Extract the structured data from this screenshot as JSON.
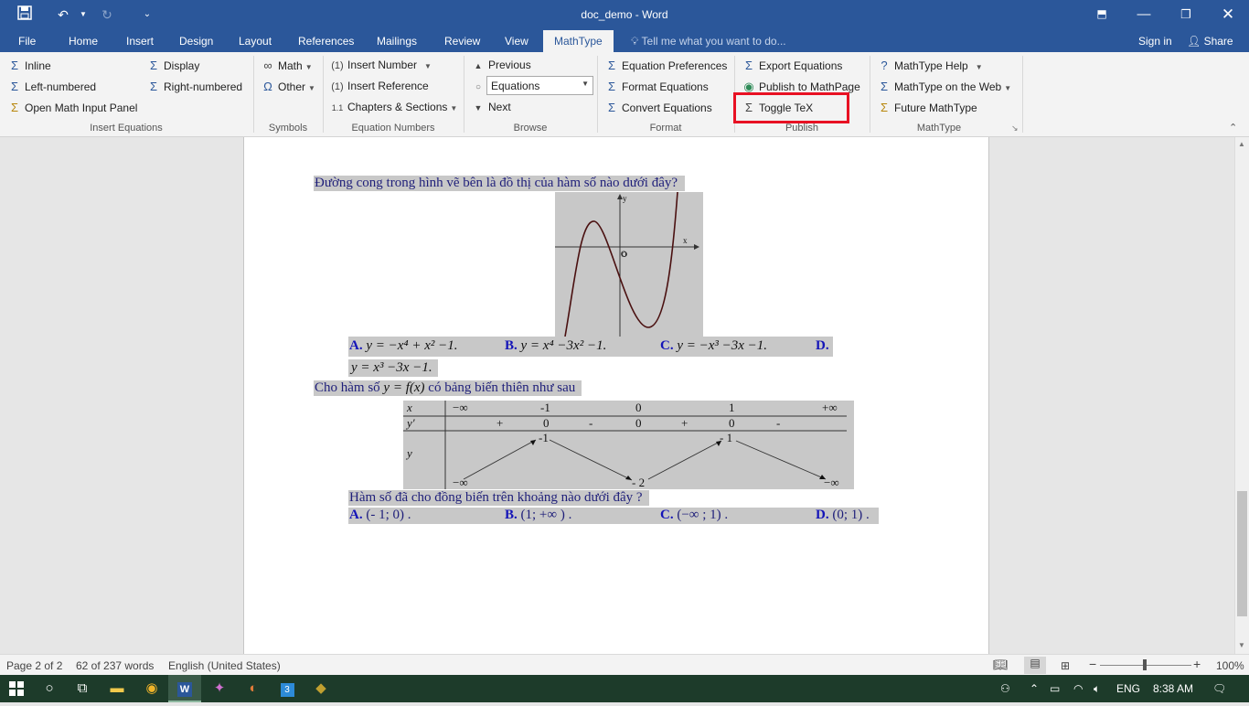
{
  "titlebar": {
    "title": "doc_demo  -  Word",
    "save_icon": "save-icon",
    "undo_icon": "undo-icon",
    "redo_icon": "redo-icon"
  },
  "tabs": [
    "File",
    "Home",
    "Insert",
    "Design",
    "Layout",
    "References",
    "Mailings",
    "Review",
    "View",
    "MathType"
  ],
  "tell_me": "Tell me what you want to do...",
  "account": {
    "sign_in": "Sign in",
    "share": "Share"
  },
  "ribbon": {
    "insert_equations": {
      "inline": "Inline",
      "display": "Display",
      "left_numbered": "Left-numbered",
      "right_numbered": "Right-numbered",
      "open_math_input": "Open Math Input Panel",
      "label": "Insert Equations"
    },
    "symbols": {
      "math": "Math",
      "other": "Other",
      "label": "Symbols"
    },
    "equation_numbers": {
      "insert_number": "Insert Number",
      "insert_reference": "Insert Reference",
      "chapters_sections": "Chapters & Sections",
      "label": "Equation Numbers"
    },
    "browse": {
      "previous": "Previous",
      "selected": "Equations",
      "next": "Next",
      "label": "Browse"
    },
    "format": {
      "equation_preferences": "Equation Preferences",
      "format_equations": "Format Equations",
      "convert_equations": "Convert Equations",
      "label": "Format"
    },
    "publish": {
      "export_equations": "Export Equations",
      "publish_mathpage": "Publish to MathPage",
      "toggle_tex": "Toggle TeX",
      "label": "Publish"
    },
    "mathtype": {
      "help": "MathType Help",
      "on_web": "MathType on the Web",
      "future": "Future MathType",
      "label": "MathType"
    }
  },
  "document": {
    "q1_text": "Đường cong trong hình vẽ bên là đồ thị của hàm số nào dưới đây?",
    "graph_labels": {
      "y": "y",
      "x": "x",
      "origin": "O"
    },
    "q1_options": [
      {
        "label": "A.",
        "expr": "y = −x⁴ + x² −1."
      },
      {
        "label": "B.",
        "expr": "y = x⁴ −3x² −1."
      },
      {
        "label": "C.",
        "expr": "y = −x³ −3x −1."
      },
      {
        "label": "D.",
        "expr": ""
      }
    ],
    "q1_option_d_expr": "y = x³ −3x −1.",
    "q2_text_pre": "Cho hàm số",
    "q2_expr": "y = f(x)",
    "q2_text_post": "có bảng biến thiên như sau",
    "table": {
      "row_x_label": "x",
      "x_values": [
        "−∞",
        "-1",
        "0",
        "1",
        "+∞"
      ],
      "row_dy_label": "y′",
      "dy_values": [
        "+",
        "0",
        "-",
        "0",
        "+",
        "0",
        "-"
      ],
      "row_y_label": "y",
      "y_values": [
        "−∞",
        "-1",
        "- 2",
        "- 1",
        "−∞"
      ]
    },
    "q2_question": "Hàm số đã cho đồng biến trên khoảng nào dưới đây ?",
    "q2_options": [
      {
        "label": "A.",
        "expr": "(- 1; 0) ."
      },
      {
        "label": "B.",
        "expr": "(1; +∞ ) ."
      },
      {
        "label": "C.",
        "expr": "(−∞ ; 1) ."
      },
      {
        "label": "D.",
        "expr": "(0; 1) ."
      }
    ]
  },
  "status": {
    "page": "Page 2 of 2",
    "words": "62 of 237 words",
    "language": "English (United States)",
    "zoom": "100%"
  },
  "taskbar": {
    "lang": "ENG",
    "time": "8:38 AM"
  },
  "colors": {
    "word_blue": "#2b579a",
    "highlight_box": "#e81123",
    "taskbar": "#1d3b2a"
  }
}
